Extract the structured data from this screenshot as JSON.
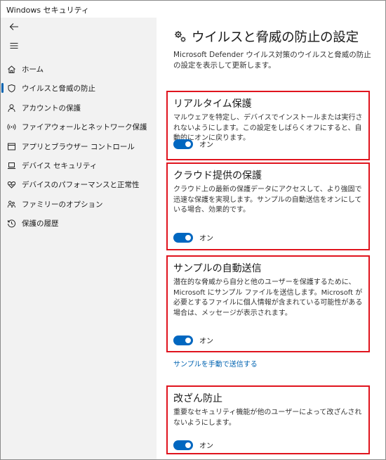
{
  "window": {
    "title": "Windows セキュリティ"
  },
  "sidebar": {
    "back_icon": "arrow-left-icon",
    "menu_icon": "hamburger-icon",
    "items": [
      {
        "label": "ホーム",
        "icon": "home-icon"
      },
      {
        "label": "ウイルスと脅威の防止",
        "icon": "shield-icon",
        "active": true
      },
      {
        "label": "アカウントの保護",
        "icon": "person-icon"
      },
      {
        "label": "ファイアウォールとネットワーク保護",
        "icon": "wireless-icon"
      },
      {
        "label": "アプリとブラウザー コントロール",
        "icon": "app-window-icon"
      },
      {
        "label": "デバイス セキュリティ",
        "icon": "laptop-icon"
      },
      {
        "label": "デバイスのパフォーマンスと正常性",
        "icon": "heart-icon"
      },
      {
        "label": "ファミリーのオプション",
        "icon": "family-icon"
      },
      {
        "label": "保護の履歴",
        "icon": "history-icon"
      }
    ]
  },
  "main": {
    "title": "ウイルスと脅威の防止の設定",
    "title_icon": "gears-icon",
    "description": "Microsoft Defender ウイルス対策のウイルスと脅威の防止の設定を表示して更新します。",
    "sections": [
      {
        "title": "リアルタイム保護",
        "text": "マルウェアを特定し、デバイスでインストールまたは実行されないようにします。この設定をしばらくオフにすると、自動的にオンに戻ります。",
        "toggle_label": "オン"
      },
      {
        "title": "クラウド提供の保護",
        "text": "クラウド上の最新の保護データにアクセスして、より強固で迅速な保護を実現します。サンプルの自動送信をオンにしている場合、効果的です。",
        "toggle_label": "オン"
      },
      {
        "title": "サンプルの自動送信",
        "text": "潜在的な脅威から自分と他のユーザーを保護するために、Microsoft にサンプル ファイルを送信します。Microsoft が必要とするファイルに個人情報が含まれている可能性がある場合は、メッセージが表示されます。",
        "toggle_label": "オン"
      },
      {
        "title": "改ざん防止",
        "text": "重要なセキュリティ機能が他のユーザーによって改ざんされないようにします。",
        "toggle_label": "オン"
      }
    ],
    "manual_submit_link": "サンプルを手動で送信する"
  },
  "colors": {
    "accent": "#0067c0",
    "highlight_border": "#e0141e",
    "link": "#0063b1",
    "sidebar_bg": "#f2f2f2"
  }
}
